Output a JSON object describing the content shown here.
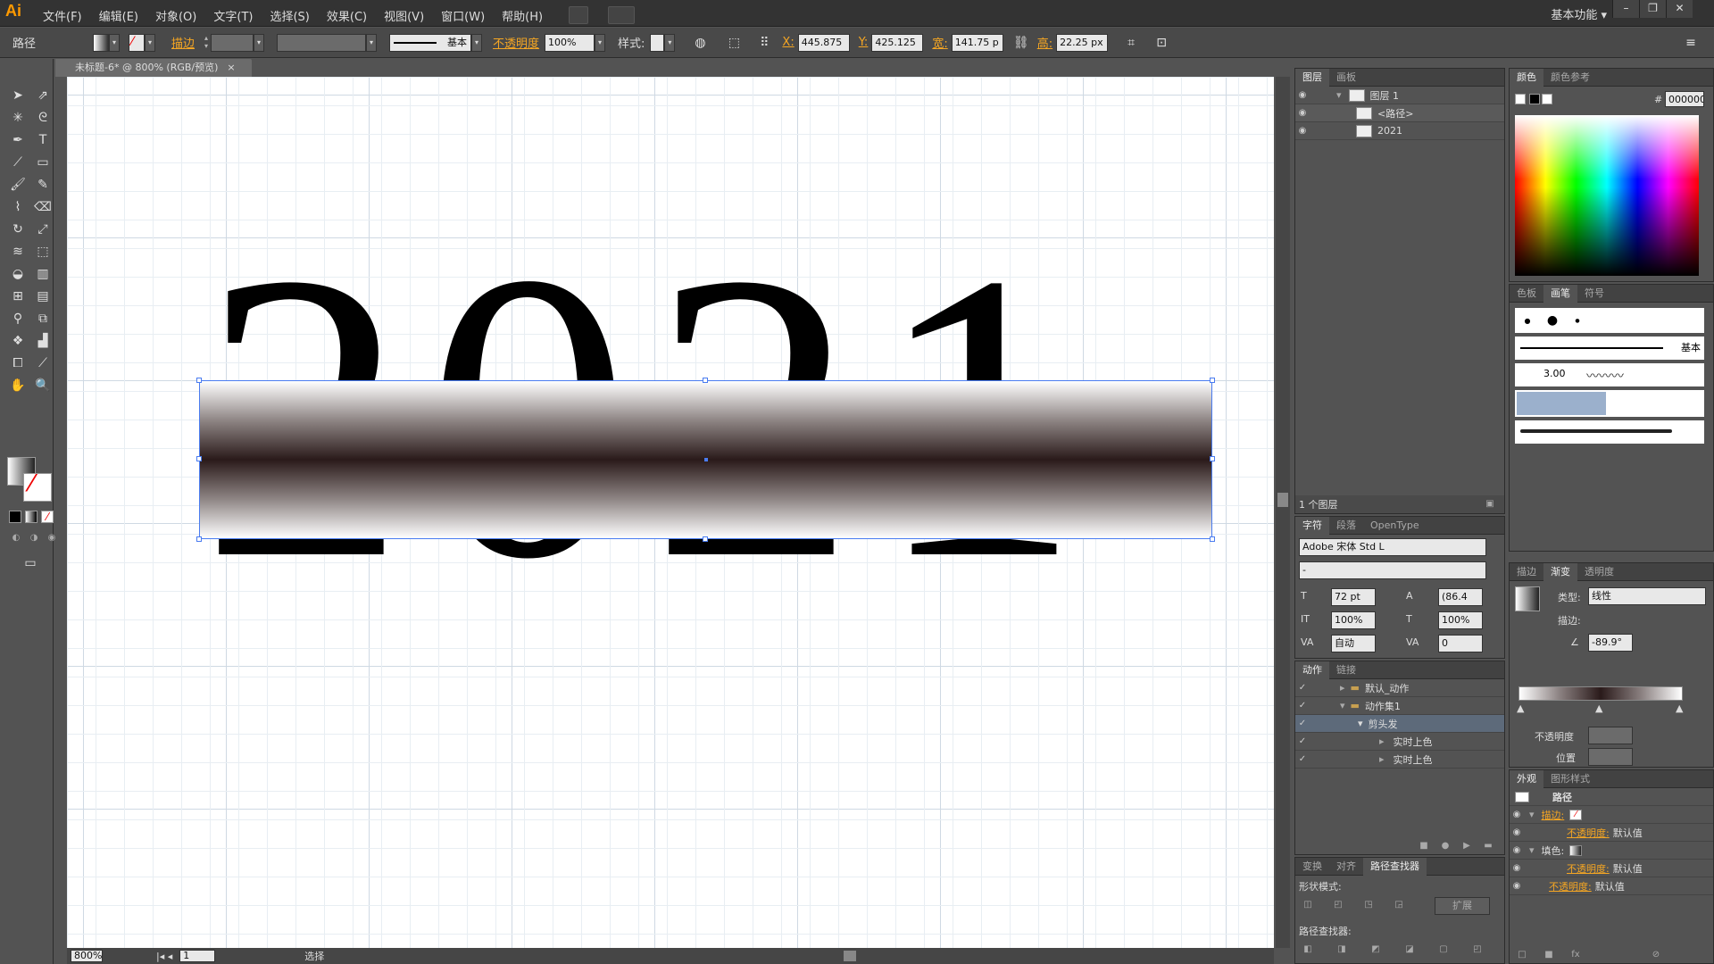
{
  "app": {
    "logo": "Ai",
    "workspace": "基本功能 ▾"
  },
  "menu": [
    "文件(F)",
    "编辑(E)",
    "对象(O)",
    "文字(T)",
    "选择(S)",
    "效果(C)",
    "视图(V)",
    "窗口(W)",
    "帮助(H)"
  ],
  "control": {
    "object_label": "路径",
    "stroke_label": "描边",
    "stroke_style": "基本",
    "opacity_label": "不透明度",
    "opacity_value": "100%",
    "style_label": "样式:",
    "x_label": "X:",
    "x_value": "445.875",
    "y_label": "Y:",
    "y_value": "425.125",
    "w_label": "宽:",
    "w_value": "141.75 p",
    "h_label": "高:",
    "h_value": "22.25 px"
  },
  "document": {
    "tab_title": "未标题-6* @ 800% (RGB/预览)",
    "artwork_text": "2021",
    "zoom": "800%",
    "page": "1",
    "status": "选择"
  },
  "layers": {
    "tabs": [
      "图层",
      "画板"
    ],
    "rows": [
      {
        "name": "图层 1"
      },
      {
        "name": "<路径>"
      },
      {
        "name": "2021"
      }
    ],
    "footer": "1 个图层"
  },
  "character": {
    "tabs": [
      "字符",
      "段落",
      "OpenType"
    ],
    "font": "Adobe 宋体 Std L",
    "style": "-",
    "size": "72 pt",
    "leading": "(86.4",
    "hscale": "100%",
    "vscale": "100%",
    "kerning": "自动",
    "tracking": "0"
  },
  "actions": {
    "tabs": [
      "动作",
      "链接"
    ],
    "rows": [
      {
        "name": "默认_动作"
      },
      {
        "name": "动作集1"
      },
      {
        "name": "剪头发"
      },
      {
        "name": "实时上色"
      },
      {
        "name": "实时上色"
      }
    ]
  },
  "pathfinder": {
    "tabs": [
      "变换",
      "对齐",
      "路径查找器"
    ],
    "shape_modes": "形状模式:",
    "expand": "扩展",
    "pathfinders": "路径查找器:"
  },
  "color": {
    "tabs": [
      "颜色",
      "颜色参考"
    ],
    "hex": "000000"
  },
  "brushes": {
    "tabs": [
      "色板",
      "画笔",
      "符号"
    ],
    "basic": "基本",
    "size": "3.00"
  },
  "gradient": {
    "tabs": [
      "描边",
      "渐变",
      "透明度"
    ],
    "type_label": "类型:",
    "type_value": "线性",
    "stroke_label": "描边:",
    "angle": "-89.9°",
    "opacity_label": "不透明度",
    "position_label": "位置"
  },
  "appearance": {
    "tabs": [
      "外观",
      "图形样式"
    ],
    "title": "路径",
    "stroke_label": "描边:",
    "opacity_label": "不透明度:",
    "default": "默认值",
    "fill_label": "填色:"
  }
}
